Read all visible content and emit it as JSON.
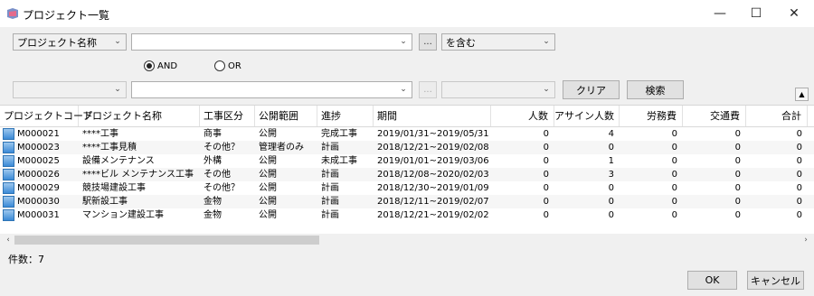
{
  "window": {
    "title": "プロジェクト一覧",
    "min_glyph": "—",
    "max_glyph": "☐",
    "close_glyph": "✕"
  },
  "filter1": {
    "field": "プロジェクト名称",
    "value": "",
    "ellipsis": "...",
    "condition": "を含む"
  },
  "logic": {
    "and_label": "AND",
    "or_label": "OR",
    "selected": "AND"
  },
  "filter2": {
    "field": "",
    "value": "",
    "ellipsis": "...",
    "condition": ""
  },
  "buttons": {
    "clear": "クリア",
    "search": "検索",
    "ok": "OK",
    "cancel": "キャンセル"
  },
  "table": {
    "columns": [
      "プロジェクトコード",
      "プロジェクト名称",
      "工事区分",
      "公開範囲",
      "進捗",
      "期間",
      "人数",
      "アサイン人数",
      "労務費",
      "交通費",
      "合計"
    ],
    "rows": [
      [
        "M000021",
        "****工事",
        "商事",
        "公開",
        "完成工事",
        "2019/01/31~2019/05/31",
        "0",
        "4",
        "0",
        "0",
        "0"
      ],
      [
        "M000023",
        "****工事見積",
        "その他？",
        "管理者のみ",
        "計画",
        "2018/12/21~2019/02/08",
        "0",
        "0",
        "0",
        "0",
        "0"
      ],
      [
        "M000025",
        "設備メンテナンス",
        "外構",
        "公開",
        "未成工事",
        "2019/01/01~2019/03/06",
        "0",
        "1",
        "0",
        "0",
        "0"
      ],
      [
        "M000026",
        "****ビル メンテナンス工事",
        "その他",
        "公開",
        "計画",
        "2018/12/08~2020/02/03",
        "0",
        "3",
        "0",
        "0",
        "0"
      ],
      [
        "M000029",
        "競技場建設工事",
        "その他？",
        "公開",
        "計画",
        "2018/12/30~2019/01/09",
        "0",
        "0",
        "0",
        "0",
        "0"
      ],
      [
        "M000030",
        "駅新設工事",
        "金物",
        "公開",
        "計画",
        "2018/12/11~2019/02/07",
        "0",
        "0",
        "0",
        "0",
        "0"
      ],
      [
        "M000031",
        "マンション建設工事",
        "金物",
        "公開",
        "計画",
        "2018/12/21~2019/02/02",
        "0",
        "0",
        "0",
        "0",
        "0"
      ]
    ]
  },
  "footer": {
    "count_text": "件数：7"
  },
  "icons": {
    "row_icon": "document-icon",
    "app_icon": "app-icon",
    "colors": {
      "row_icon": "#3b8ad6",
      "row_alt_bg": "#f6f6f6"
    }
  }
}
